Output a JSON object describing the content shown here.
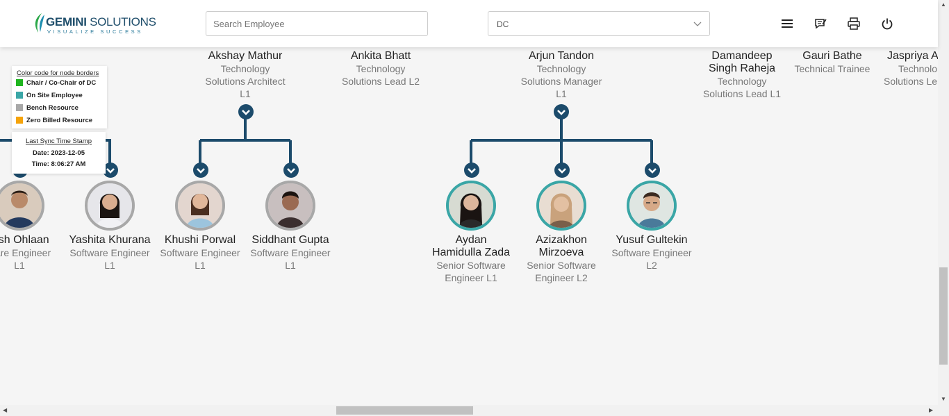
{
  "header": {
    "logo": {
      "brand_bold": "GEMINI",
      "brand_rest": " SOLUTIONS",
      "tagline": "VISUALIZE SUCCESS"
    },
    "search": {
      "placeholder": "Search Employee",
      "value": ""
    },
    "department_select": {
      "selected": "DC"
    },
    "icons": [
      "menu-icon",
      "feedback-icon",
      "print-icon",
      "power-icon"
    ]
  },
  "colors": {
    "brand": "#1f4e6b",
    "connector": "#1c4b6b",
    "chair": "#1fb51f",
    "on_site": "#3aa6a6",
    "bench": "#a8a8a8",
    "zero_billed": "#f5a30a"
  },
  "legend": {
    "title": "Color code for node borders",
    "items": [
      {
        "label": "Chair / Co-Chair of DC",
        "color": "#1fb51f"
      },
      {
        "label": "On Site Employee",
        "color": "#3aa6a6"
      },
      {
        "label": "Bench Resource",
        "color": "#a8a8a8"
      },
      {
        "label": "Zero Billed Resource",
        "color": "#f5a30a"
      }
    ]
  },
  "sync": {
    "title": "Last Sync Time Stamp",
    "date": "Date: 2023-12-05",
    "time": "Time: 8:06:27 AM"
  },
  "top_row": [
    {
      "name": "Akshay Mathur",
      "role_lines": [
        "Technology",
        "Solutions Architect",
        "L1"
      ]
    },
    {
      "name": "Ankita Bhatt",
      "role_lines": [
        "Technology",
        "Solutions Lead L2"
      ]
    },
    {
      "name": "Arjun Tandon",
      "role_lines": [
        "Technology",
        "Solutions Manager",
        "L1"
      ]
    },
    {
      "name_lines": [
        "Damandeep",
        "Singh Raheja"
      ],
      "role_lines": [
        "Technology",
        "Solutions Lead L1"
      ]
    },
    {
      "name": "Gauri Bathe",
      "role_lines": [
        "Technical Trainee"
      ]
    },
    {
      "name": "Jaspriya A",
      "role_lines": [
        "Technolo",
        "Solutions Le"
      ]
    }
  ],
  "bottom_row": [
    {
      "name": "jash Ohlaan",
      "role_lines": [
        "ware Engineer",
        "L1"
      ],
      "border": "bench"
    },
    {
      "name": "Yashita Khurana",
      "role_lines": [
        "Software Engineer",
        "L1"
      ],
      "border": "bench"
    },
    {
      "name": "Khushi Porwal",
      "role_lines": [
        "Software Engineer",
        "L1"
      ],
      "border": "bench"
    },
    {
      "name": "Siddhant Gupta",
      "role_lines": [
        "Software Engineer",
        "L1"
      ],
      "border": "bench"
    },
    {
      "name_lines": [
        "Aydan",
        "Hamidulla Zada"
      ],
      "role_lines": [
        "Senior Software",
        "Engineer L1"
      ],
      "border": "on_site"
    },
    {
      "name_lines": [
        "Azizakhon",
        "Mirzoeva"
      ],
      "role_lines": [
        "Senior Software",
        "Engineer L2"
      ],
      "border": "on_site"
    },
    {
      "name": "Yusuf Gultekin",
      "role_lines": [
        "Software Engineer",
        "L2"
      ],
      "border": "on_site"
    }
  ]
}
